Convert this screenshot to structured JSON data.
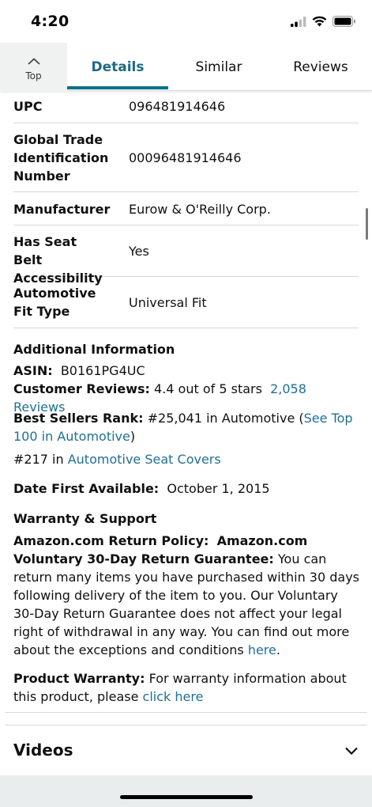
{
  "status_bar": {
    "time": "4:20"
  },
  "tabs": {
    "top_label": "Top",
    "items": [
      {
        "label": "Details",
        "active": true
      },
      {
        "label": "Similar",
        "active": false
      },
      {
        "label": "Reviews",
        "active": false
      }
    ]
  },
  "specs": [
    {
      "key": "UPC",
      "value": "096481914646"
    },
    {
      "key": "Global Trade Identification Number",
      "value": "00096481914646"
    },
    {
      "key": "Manufacturer",
      "value": "Eurow & O'Reilly Corp."
    },
    {
      "key": "Has Seat Belt Accessibility",
      "value": "Yes"
    },
    {
      "key": "Automotive Fit Type",
      "value": "Universal Fit"
    }
  ],
  "additional": {
    "heading": "Additional Information",
    "asin_label": "ASIN:",
    "asin_value": "B0161PG4UC",
    "reviews_label": "Customer Reviews:",
    "reviews_value": "4.4 out of 5 stars",
    "reviews_link": "2,058 Reviews",
    "rank_label": "Best Sellers Rank:",
    "rank_value": "#25,041 in Automotive (",
    "rank_link": "See Top 100 in Automotive",
    "rank_close": ")",
    "subrank_value": "#217 in",
    "subrank_link": "Automotive Seat Covers",
    "date_label": "Date First Available:",
    "date_value": "October 1, 2015"
  },
  "warranty": {
    "heading": "Warranty & Support",
    "policy_label": "Amazon.com Return Policy:",
    "policy_bold": "Amazon.com Voluntary 30-Day Return Guarantee:",
    "policy_text": "You can return many items you have purchased within 30 days following delivery of the item to you. Our Voluntary 30-Day Return Guarantee does not affect your legal right of withdrawal in any way. You can find out more about the exceptions and conditions",
    "policy_link": "here",
    "policy_end": ".",
    "product_warranty_label": "Product Warranty:",
    "product_warranty_text": "For warranty information about this product, please",
    "product_warranty_link": "click here"
  },
  "videos": {
    "title": "Videos"
  },
  "colors": {
    "accent": "#0a7087",
    "link": "#1f6f93",
    "divider": "#d5d9d9"
  }
}
